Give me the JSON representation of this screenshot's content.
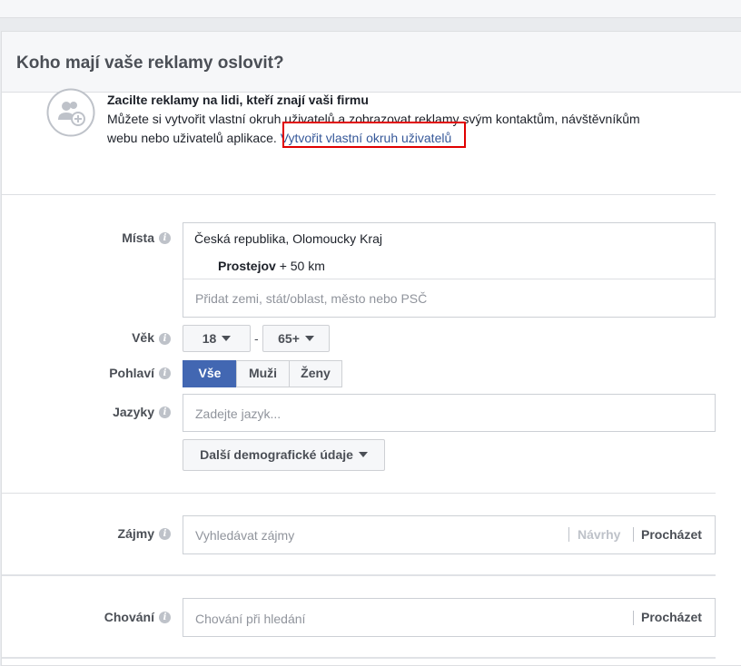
{
  "section": {
    "title": "Koho mají vaše reklamy oslovit?"
  },
  "custom_audience": {
    "icon": "people-add-icon",
    "title": "Zacilte reklamy na lidi, kteří znají vaši firmu",
    "desc_line1": "Můžete si vytvořit vlastní okruh uživatelů a zobrazovat reklamy svým kontaktům, návštěvníkům",
    "desc_line2": "webu nebo uživatelů aplikace.",
    "link_label": "Vytvořit vlastní okruh uživatelů"
  },
  "locations": {
    "label": "Místa",
    "country": "Česká republika, Olomoucky Kraj",
    "city": "Prostejov",
    "radius": "+ 50 km",
    "placeholder": "Přidat zemi, stát/oblast, město nebo PSČ"
  },
  "age": {
    "label": "Věk",
    "min": "18",
    "dash": "-",
    "max": "65+"
  },
  "gender": {
    "label": "Pohlaví",
    "options": [
      "Vše",
      "Muži",
      "Ženy"
    ],
    "selected": "Vše"
  },
  "languages": {
    "label": "Jazyky",
    "placeholder": "Zadejte jazyk..."
  },
  "demographics": {
    "button_label": "Další demografické údaje"
  },
  "interests": {
    "label": "Zájmy",
    "placeholder": "Vyhledávat zájmy",
    "suggestions": "Návrhy",
    "browse": "Procházet"
  },
  "behaviors": {
    "label": "Chování",
    "placeholder": "Chování při hledání",
    "browse": "Procházet"
  },
  "colors": {
    "accent": "#4267b2",
    "link": "#365899",
    "highlight": "#e00000"
  }
}
